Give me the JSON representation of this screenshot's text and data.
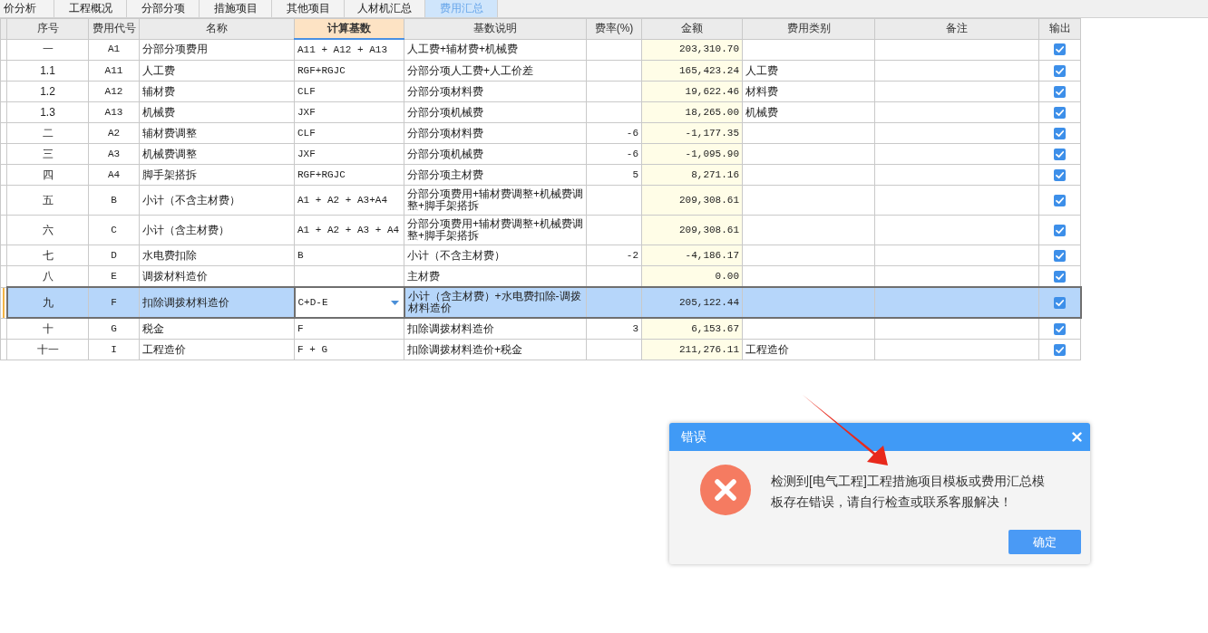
{
  "tabs": [
    {
      "label": "价分析",
      "selected": false
    },
    {
      "label": "工程概况",
      "selected": false
    },
    {
      "label": "分部分项",
      "selected": false
    },
    {
      "label": "措施项目",
      "selected": false
    },
    {
      "label": "其他项目",
      "selected": false
    },
    {
      "label": "人材机汇总",
      "selected": false
    },
    {
      "label": "费用汇总",
      "selected": true
    }
  ],
  "table": {
    "columns": [
      {
        "label": "序号",
        "selected": false
      },
      {
        "label": "费用代号",
        "selected": false
      },
      {
        "label": "名称",
        "selected": false
      },
      {
        "label": "计算基数",
        "selected": true
      },
      {
        "label": "基数说明",
        "selected": false
      },
      {
        "label": "费率(%)",
        "selected": false
      },
      {
        "label": "金额",
        "selected": false
      },
      {
        "label": "费用类别",
        "selected": false
      },
      {
        "label": "备注",
        "selected": false
      },
      {
        "label": "输出",
        "selected": false
      }
    ],
    "rows": [
      {
        "no": "一",
        "code": "A1",
        "name": "分部分项费用",
        "calc_base": "A11 + A12 + A13",
        "base_note": "人工费+辅材费+机械费",
        "amount": "203,310.70",
        "output": true,
        "selected": false
      },
      {
        "no": "1.1",
        "code": "A11",
        "name": "人工费",
        "calc_base": "RGF+RGJC",
        "base_note": "分部分项人工费+人工价差",
        "amount": "165,423.24",
        "category": "人工费",
        "output": true,
        "selected": false
      },
      {
        "no": "1.2",
        "code": "A12",
        "name": "辅材费",
        "calc_base": "CLF",
        "base_note": "分部分项材料费",
        "amount": "19,622.46",
        "category": "材料费",
        "output": true,
        "selected": false
      },
      {
        "no": "1.3",
        "code": "A13",
        "name": "机械费",
        "calc_base": "JXF",
        "base_note": "分部分项机械费",
        "amount": "18,265.00",
        "category": "机械费",
        "output": true,
        "selected": false
      },
      {
        "no": "二",
        "code": "A2",
        "name": "辅材费调整",
        "calc_base": "CLF",
        "base_note": "分部分项材料费",
        "rate": "-6",
        "amount": "-1,177.35",
        "output": true,
        "selected": false
      },
      {
        "no": "三",
        "code": "A3",
        "name": "机械费调整",
        "calc_base": "JXF",
        "base_note": "分部分项机械费",
        "rate": "-6",
        "amount": "-1,095.90",
        "output": true,
        "selected": false
      },
      {
        "no": "四",
        "code": "A4",
        "name": "脚手架搭拆",
        "calc_base": "RGF+RGJC",
        "base_note": "分部分项主材费",
        "rate": "5",
        "amount": "8,271.16",
        "output": true,
        "selected": false
      },
      {
        "no": "五",
        "code": "B",
        "name": "小计（不含主材费）",
        "calc_base": "A1 + A2 + A3+A4",
        "base_note": "分部分项费用+辅材费调整+机械费调整+脚手架搭拆",
        "amount": "209,308.61",
        "output": true,
        "selected": false
      },
      {
        "no": "六",
        "code": "C",
        "name": "小计（含主材费）",
        "calc_base": "A1 + A2 + A3 + A4",
        "base_note": "分部分项费用+辅材费调整+机械费调整+脚手架搭拆",
        "amount": "209,308.61",
        "output": true,
        "selected": false
      },
      {
        "no": "七",
        "code": "D",
        "name": "水电费扣除",
        "calc_base": "B",
        "base_note": "小计（不含主材费）",
        "rate": "-2",
        "amount": "-4,186.17",
        "output": true,
        "selected": false
      },
      {
        "no": "八",
        "code": "E",
        "name": "调拨材料造价",
        "base_note": "主材费",
        "amount": "0.00",
        "output": true,
        "selected": false
      },
      {
        "no": "九",
        "code": "F",
        "name": "扣除调拨材料造价",
        "calc_base": "C+D-E",
        "base_note": "小计（含主材费）+水电费扣除-调拨材料造价",
        "amount": "205,122.44",
        "output": true,
        "selected": true
      },
      {
        "no": "十",
        "code": "G",
        "name": "税金",
        "calc_base": "F",
        "base_note": "扣除调拨材料造价",
        "rate": "3",
        "amount": "6,153.67",
        "output": true,
        "selected": false
      },
      {
        "no": "十一",
        "code": "I",
        "name": "工程造价",
        "calc_base": "F + G",
        "base_note": "扣除调拨材料造价+税金",
        "amount": "211,276.11",
        "category": "工程造价",
        "output": true,
        "selected": false
      }
    ]
  },
  "dialog": {
    "title": "错误",
    "kind": "error",
    "message": "检测到[电气工程]工程措施项目模板或费用汇总模板存在错误，请自行检查或联系客服解决！",
    "buttons": [
      "确定"
    ]
  },
  "annotations": [
    {
      "kind": "arrow"
    }
  ]
}
